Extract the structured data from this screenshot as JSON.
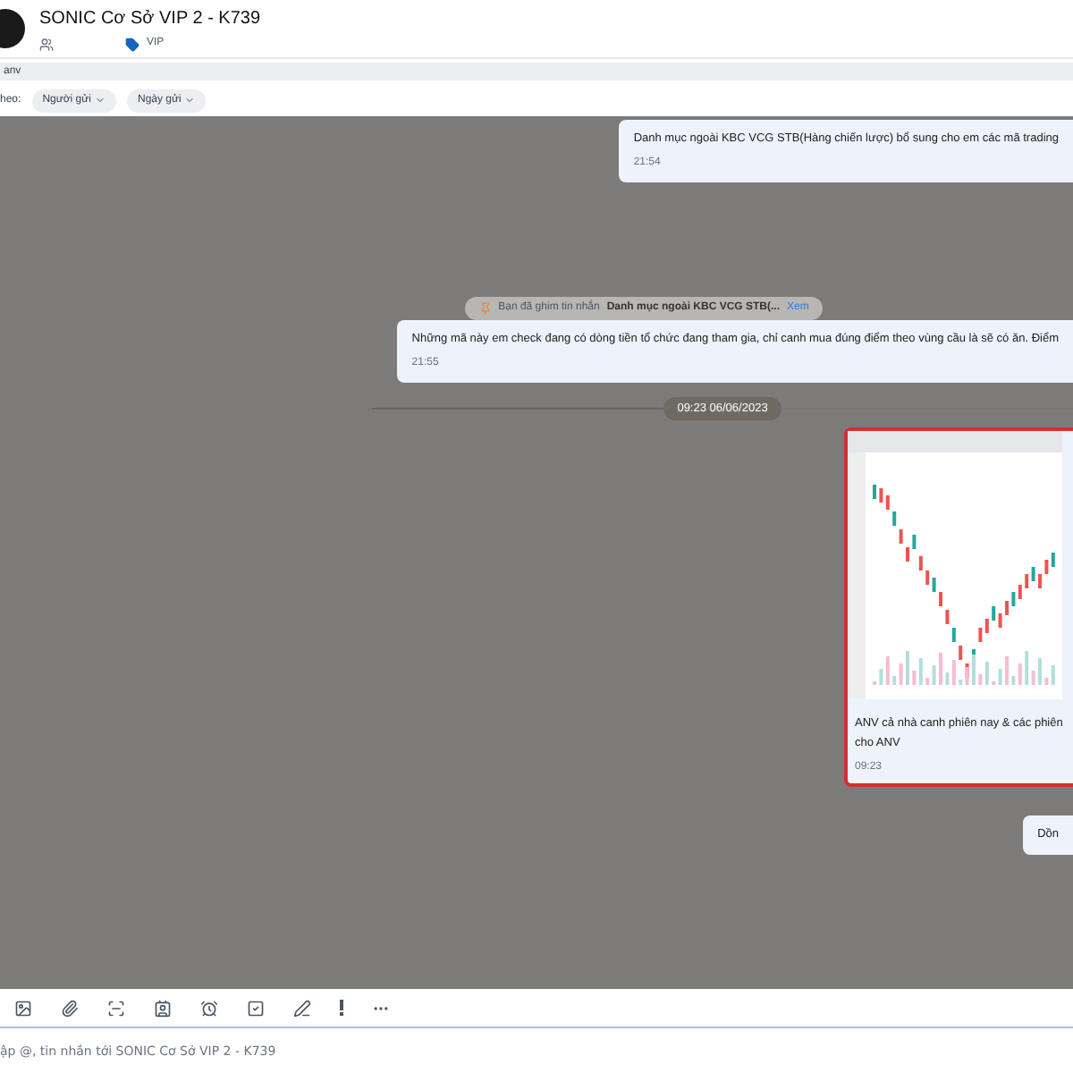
{
  "header": {
    "title": "SONIC Cơ Sở VIP 2 - K739",
    "tag": "VIP"
  },
  "search": {
    "value": "anv"
  },
  "filters": {
    "label": "heo:",
    "chips": [
      "Người gửi",
      "Ngày gửi"
    ]
  },
  "messages": [
    {
      "kind": "text",
      "text": "Danh mục ngoài KBC VCG STB(Hàng chiến lược) bổ sung cho em các mã trading",
      "time": "21:54",
      "selected": false
    },
    {
      "kind": "pin",
      "prefix": "Bạn đã ghim tin nhắn",
      "text": "Danh mục ngoài KBC VCG STB(...",
      "link": "Xem"
    },
    {
      "kind": "text",
      "text": "Những mã này em check đang có dòng tiền tổ chức đang tham gia, chỉ canh mua đúng điểm theo vùng cầu là sẽ có ăn. Điểm",
      "time": "21:55",
      "selected": false
    },
    {
      "kind": "date",
      "text": "09:23 06/06/2023"
    },
    {
      "kind": "image",
      "text": "ANV cả nhà canh phiên nay & các phiên\ncho ANV",
      "time": "09:23",
      "selected": true
    },
    {
      "kind": "text",
      "text": "Dồn",
      "selected": false
    }
  ],
  "composer": {
    "placeholder": "ập @, tin nhắn tới SONIC Cơ Sở VIP 2 - K739"
  }
}
